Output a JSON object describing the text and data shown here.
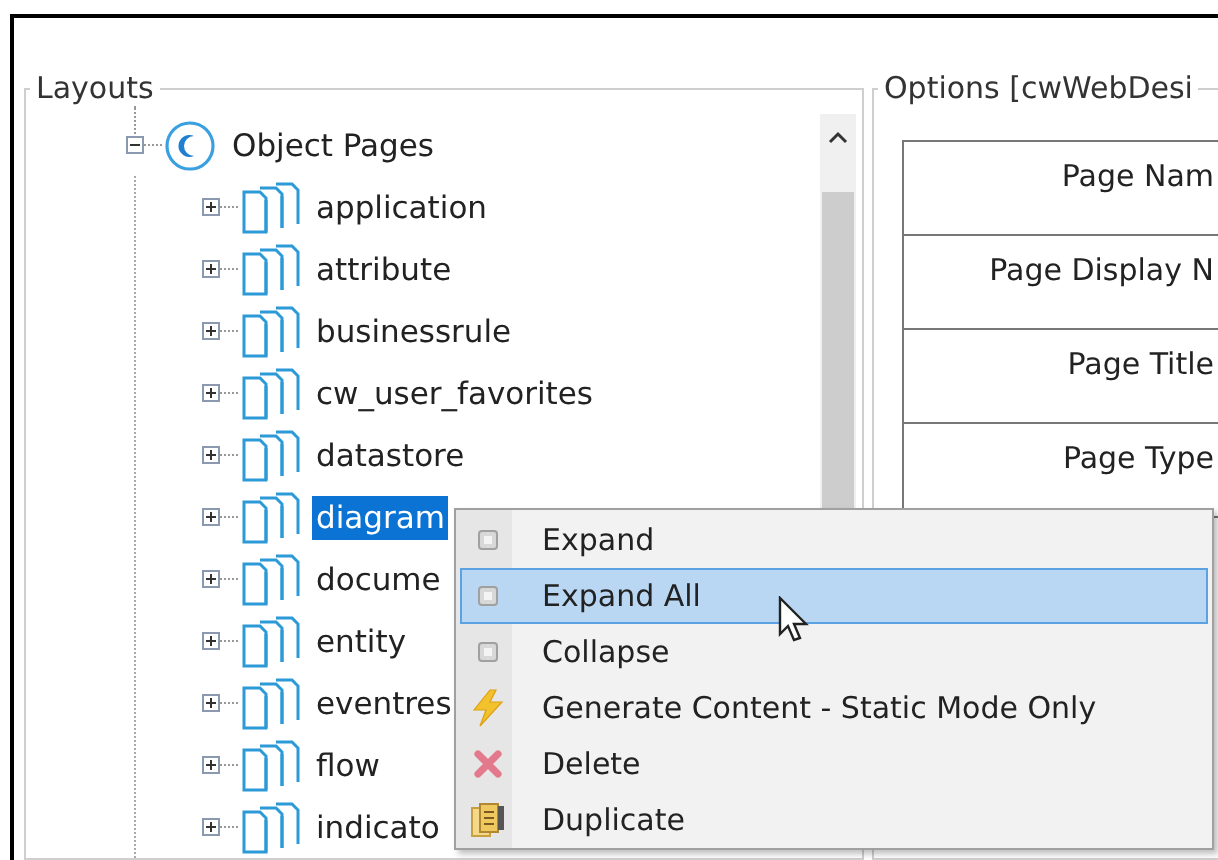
{
  "layouts": {
    "title": "Layouts",
    "tree": [
      {
        "label": "Object Pages",
        "kind": "root",
        "expanded": true,
        "selected": false,
        "children": [
          {
            "label": "application",
            "kind": "pages",
            "expanded": false,
            "selected": false
          },
          {
            "label": "attribute",
            "kind": "pages",
            "expanded": false,
            "selected": false
          },
          {
            "label": "businessrule",
            "kind": "pages",
            "expanded": false,
            "selected": false
          },
          {
            "label": "cw_user_favorites",
            "kind": "pages",
            "expanded": false,
            "selected": false
          },
          {
            "label": "datastore",
            "kind": "pages",
            "expanded": false,
            "selected": false
          },
          {
            "label": "diagram",
            "kind": "pages",
            "expanded": false,
            "selected": true
          },
          {
            "label": "docume",
            "kind": "pages",
            "expanded": false,
            "selected": false
          },
          {
            "label": "entity",
            "kind": "pages",
            "expanded": false,
            "selected": false
          },
          {
            "label": "eventres",
            "kind": "pages",
            "expanded": false,
            "selected": false
          },
          {
            "label": "flow",
            "kind": "pages",
            "expanded": false,
            "selected": false
          },
          {
            "label": "indicato",
            "kind": "pages",
            "expanded": false,
            "selected": false
          }
        ]
      }
    ]
  },
  "options": {
    "title": "Options [cwWebDesi",
    "rows": [
      "Page Nam",
      "Page Display N",
      "Page Title",
      "Page Type"
    ]
  },
  "context_menu": {
    "items": [
      {
        "label": "Expand",
        "kind": "square",
        "selected": false
      },
      {
        "label": "Expand All",
        "kind": "square",
        "selected": true
      },
      {
        "label": "Collapse",
        "kind": "square",
        "selected": false
      },
      {
        "label": "Generate Content - Static Mode Only",
        "kind": "bolt",
        "selected": false
      },
      {
        "label": "Delete",
        "kind": "delete",
        "selected": false
      },
      {
        "label": "Duplicate",
        "kind": "duplicate",
        "selected": false
      }
    ]
  }
}
